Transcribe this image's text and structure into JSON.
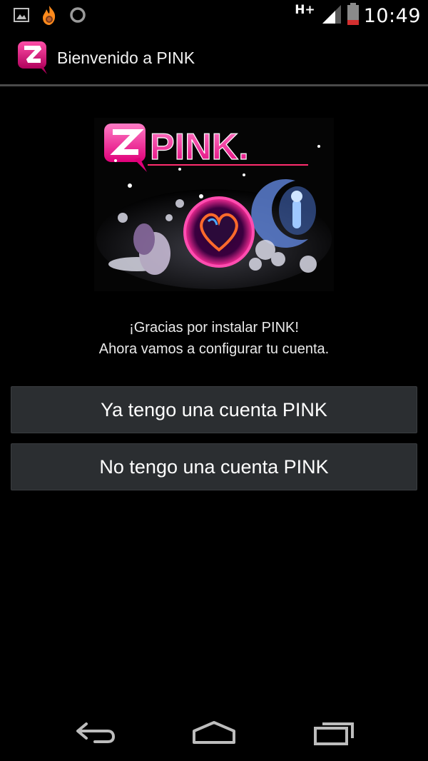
{
  "status_bar": {
    "network": "H+",
    "time": "10:49",
    "icons": [
      "image-notification-icon",
      "hotspot-flame-icon",
      "sync-circle-icon",
      "signal-icon",
      "battery-icon"
    ]
  },
  "action_bar": {
    "title": "Bienvenido a PINK",
    "icon": "pink-app-icon"
  },
  "banner": {
    "logo_text": "PINK."
  },
  "welcome": {
    "line1": "¡Gracias por instalar PINK!",
    "line2": "Ahora vamos a configurar tu cuenta."
  },
  "buttons": {
    "have_account": "Ya tengo una cuenta PINK",
    "no_account": "No tengo una cuenta PINK"
  },
  "nav_bar": {
    "icons": [
      "back-icon",
      "home-icon",
      "recent-apps-icon"
    ]
  },
  "colors": {
    "brand_pink": "#e6137d",
    "button_bg": "#2b2e31",
    "divider": "#4a4a4a"
  }
}
